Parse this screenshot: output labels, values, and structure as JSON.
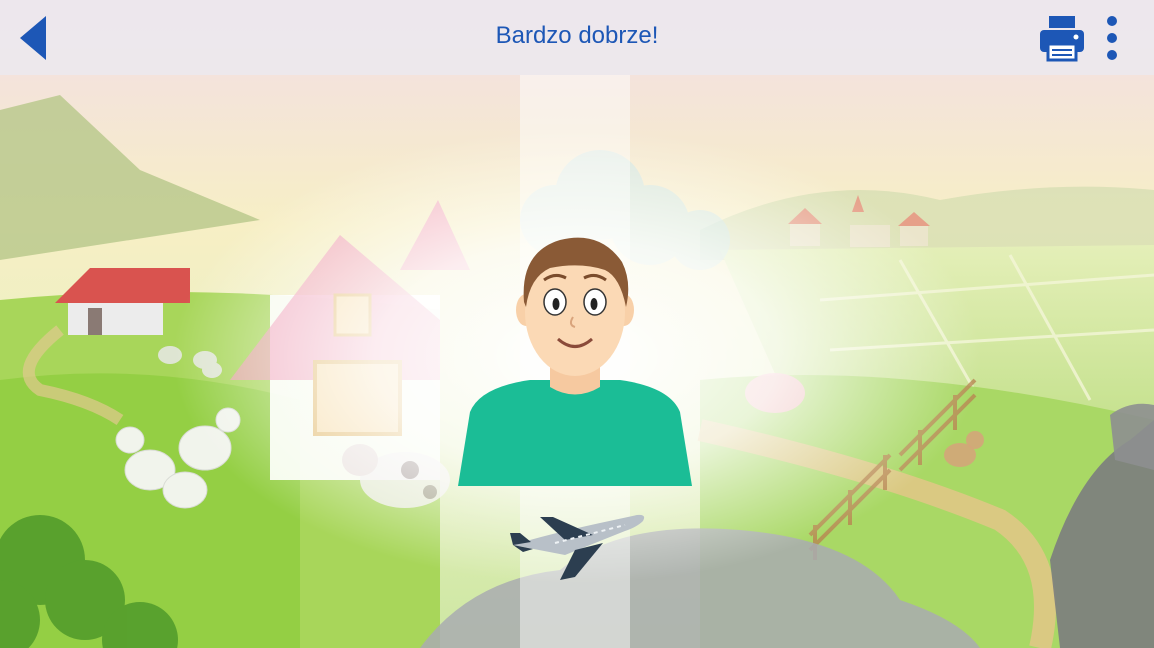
{
  "header": {
    "title": "Bardzo dobrze!",
    "back_icon": "chevron-left-icon",
    "print_icon": "printer-icon",
    "menu_icon": "more-vertical-icon"
  },
  "colors": {
    "accent": "#1d57b6",
    "shirt": "#1bbd96",
    "hair": "#8a5a36",
    "skin": "#fbd9b5"
  },
  "scene": {
    "description_icons": [
      "farm-background",
      "man-picture",
      "airplane-icon"
    ]
  }
}
